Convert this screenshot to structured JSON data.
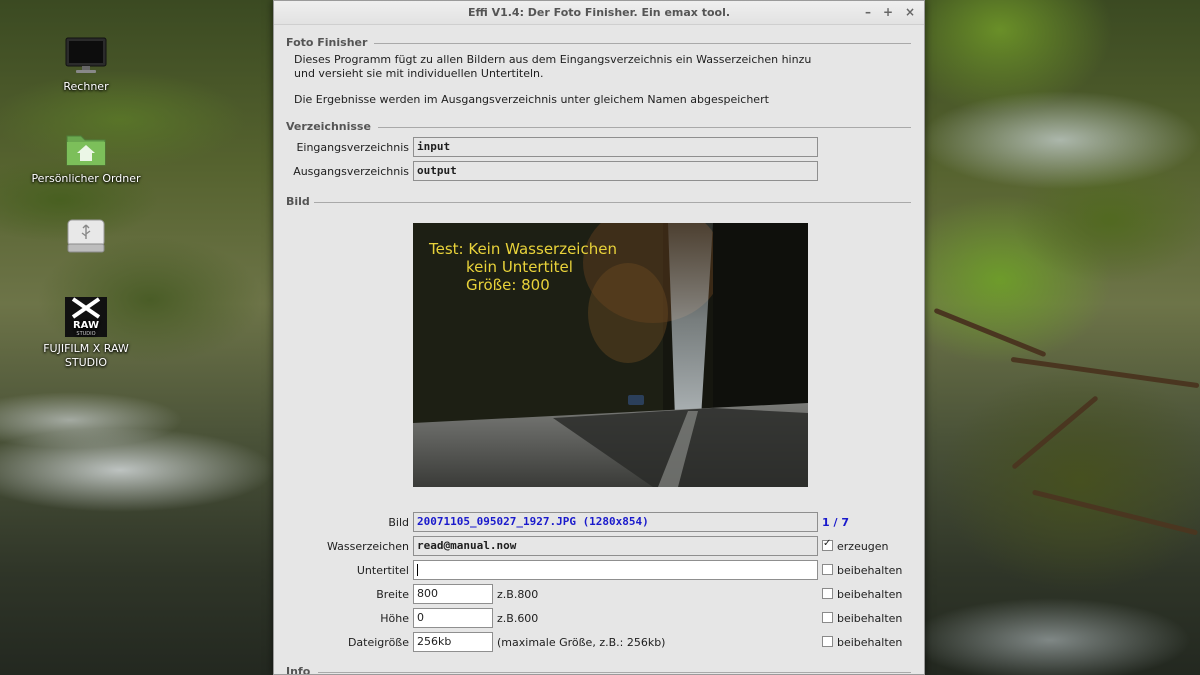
{
  "desktop": {
    "icons": [
      {
        "label": "Rechner",
        "icon": "computer-monitor-icon"
      },
      {
        "label": "Persönlicher Ordner",
        "icon": "home-folder-icon"
      },
      {
        "label": "",
        "icon": "usb-drive-icon"
      },
      {
        "label": "FUJIFILM X RAW STUDIO",
        "icon": "fujifilm-x-raw-studio-icon",
        "logo_text": [
          "X",
          "RAW",
          "STUDIO"
        ]
      }
    ]
  },
  "window": {
    "title": "Effi V1.4: Der Foto Finisher. Ein emax tool.",
    "controls": {
      "minimize": "–",
      "maximize": "+",
      "close": "×"
    }
  },
  "foto_finisher": {
    "heading": "Foto Finisher",
    "description_line1": "Dieses Programm fügt zu allen Bildern aus dem Eingangsverzeichnis ein Wasserzeichen hinzu",
    "description_line2": "und versieht sie mit individuellen Untertiteln.",
    "description_line3": "Die Ergebnisse werden im Ausgangsverzeichnis unter gleichem Namen abgespeichert"
  },
  "verzeichnisse": {
    "heading": "Verzeichnisse",
    "input_label": "Eingangsverzeichnis",
    "input_value": "input",
    "output_label": "Ausgangsverzeichnis",
    "output_value": "output"
  },
  "bild": {
    "heading": "Bild",
    "preview_overlay": {
      "line1": "Test: Kein Wasserzeichen",
      "line2": "kein Untertitel",
      "line3": "Größe: 800",
      "color": "#e8d23a"
    },
    "image_label": "Bild",
    "image_value": "20071105_095027_1927.JPG (1280x854)",
    "image_counter": "1 / 7",
    "watermark_label": "Wasserzeichen",
    "watermark_value": "read@manual.now",
    "watermark_check_label": "erzeugen",
    "watermark_checked": true,
    "subtitle_label": "Untertitel",
    "subtitle_value": "",
    "subtitle_check_label": "beibehalten",
    "subtitle_checked": false,
    "width_label": "Breite",
    "width_value": "800",
    "width_hint": "z.B.800",
    "width_check_label": "beibehalten",
    "width_checked": false,
    "height_label": "Höhe",
    "height_value": "0",
    "height_hint": "z.B.600",
    "height_check_label": "beibehalten",
    "height_checked": false,
    "filesize_label": "Dateigröße",
    "filesize_value": "256kb",
    "filesize_hint": "(maximale Größe, z.B.: 256kb)",
    "filesize_check_label": "beibehalten",
    "filesize_checked": false
  },
  "info": {
    "heading": "Info"
  },
  "colors": {
    "accent_text": "#1a1acc",
    "window_bg": "#e6e6e6"
  }
}
